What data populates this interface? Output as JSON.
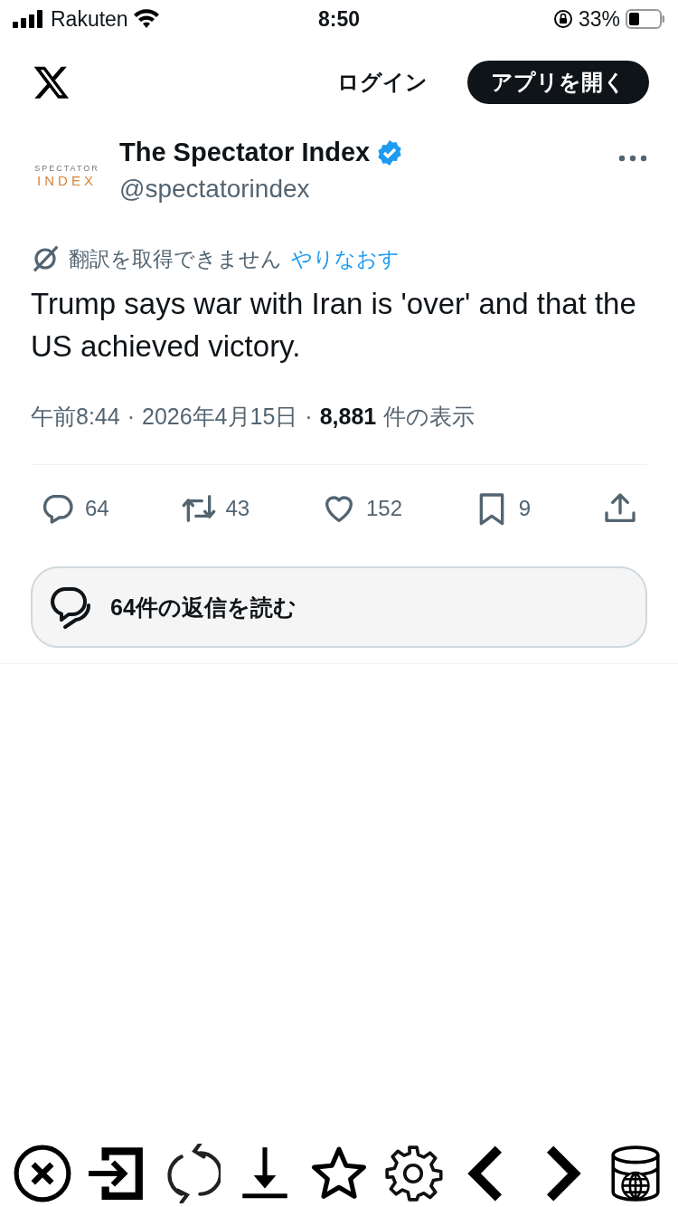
{
  "status_bar": {
    "carrier": "Rakuten",
    "time": "8:50",
    "battery": "33%"
  },
  "header": {
    "login": "ログイン",
    "open_app": "アプリを開く"
  },
  "tweet": {
    "avatar_lines": [
      "SPECTATOR",
      "INDEX"
    ],
    "name": "The Spectator Index",
    "verified": true,
    "handle": "@spectatorindex",
    "translation": {
      "message": "翻訳を取得できません",
      "retry": "やりなおす"
    },
    "text": "Trump says war with Iran is 'over' and that the US achieved victory.",
    "meta": [
      {
        "kind": "time",
        "text": "午前8:44"
      },
      {
        "kind": "separator",
        "text": "·"
      },
      {
        "kind": "date",
        "text": "2026年4月15日"
      },
      {
        "kind": "separator",
        "text": "·"
      },
      {
        "kind": "views",
        "text": "8,881"
      },
      {
        "kind": "views_label",
        "text": "件の表示"
      }
    ],
    "actions": [
      {
        "kind": "reply",
        "count": "64"
      },
      {
        "kind": "repost",
        "count": "43"
      },
      {
        "kind": "like",
        "count": "152"
      },
      {
        "kind": "bookmark",
        "count": "9"
      },
      {
        "kind": "share"
      }
    ],
    "read_replies": "64件の返信を読む"
  },
  "toolbar": [
    {
      "kind": "close"
    },
    {
      "kind": "enter"
    },
    {
      "kind": "reload"
    },
    {
      "kind": "download"
    },
    {
      "kind": "star"
    },
    {
      "kind": "settings"
    },
    {
      "kind": "back"
    },
    {
      "kind": "forward"
    },
    {
      "kind": "database"
    }
  ]
}
